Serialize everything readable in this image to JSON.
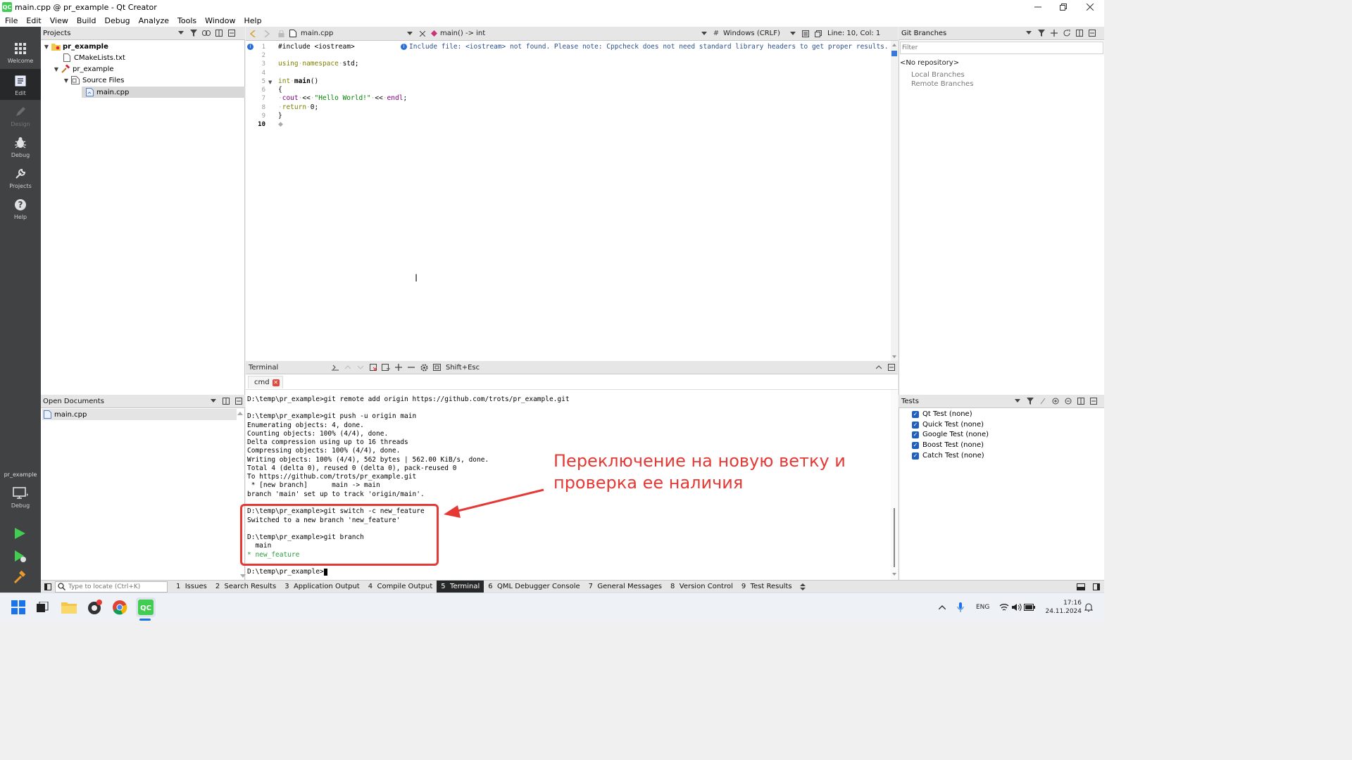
{
  "window": {
    "title": "main.cpp @ pr_example - Qt Creator",
    "logo": "QC"
  },
  "menu": [
    "File",
    "Edit",
    "View",
    "Build",
    "Debug",
    "Analyze",
    "Tools",
    "Window",
    "Help"
  ],
  "modes": [
    {
      "label": "Welcome",
      "icon": "grid-icon"
    },
    {
      "label": "Edit",
      "icon": "edit-icon"
    },
    {
      "label": "Design",
      "icon": "pencil-icon"
    },
    {
      "label": "Debug",
      "icon": "bug-icon"
    },
    {
      "label": "Projects",
      "icon": "wrench-icon"
    },
    {
      "label": "Help",
      "icon": "help-icon"
    }
  ],
  "kit": {
    "project": "pr_example",
    "mode": "Debug"
  },
  "projects": {
    "header": "Projects",
    "tree": [
      {
        "label": "pr_example",
        "bold": true
      },
      {
        "label": "CMakeLists.txt"
      },
      {
        "label": "pr_example"
      },
      {
        "label": "Source Files"
      },
      {
        "label": "main.cpp",
        "selected": true
      }
    ]
  },
  "open_documents": {
    "header": "Open Documents",
    "items": [
      "main.cpp"
    ]
  },
  "editor_toolbar": {
    "file": "main.cpp",
    "symbol": "main() -> int",
    "line_endings": "Windows (CRLF)",
    "position": "Line: 10, Col: 1",
    "hash": "#"
  },
  "editor": {
    "warning": "Include file: <iostream> not found. Please note: Cppcheck does not need standard library headers to get proper results.",
    "line_numbers": [
      "1",
      "2",
      "3",
      "4",
      "5",
      "6",
      "7",
      "8",
      "9",
      "10"
    ],
    "lines": [
      "#include <iostream>",
      "",
      "using namespace std;",
      "",
      "int main()",
      "{",
      "    cout << \"Hello World!\" << endl;",
      "    return 0;",
      "}",
      ""
    ]
  },
  "terminal": {
    "header": "Terminal",
    "shortcut": "Shift+Esc",
    "tab": "cmd",
    "lines": [
      "D:\\temp\\pr_example>git remote add origin https://github.com/trots/pr_example.git",
      "",
      "D:\\temp\\pr_example>git push -u origin main",
      "Enumerating objects: 4, done.",
      "Counting objects: 100% (4/4), done.",
      "Delta compression using up to 16 threads",
      "Compressing objects: 100% (4/4), done.",
      "Writing objects: 100% (4/4), 562 bytes | 562.00 KiB/s, done.",
      "Total 4 (delta 0), reused 0 (delta 0), pack-reused 0",
      "To https://github.com/trots/pr_example.git",
      " * [new branch]      main -> main",
      "branch 'main' set up to track 'origin/main'.",
      "",
      "D:\\temp\\pr_example>git switch -c new_feature",
      "Switched to a new branch 'new_feature'",
      "",
      "D:\\temp\\pr_example>git branch",
      "  main",
      "* new_feature",
      "",
      "D:\\temp\\pr_example>"
    ]
  },
  "git_branches": {
    "header": "Git Branches",
    "filter_placeholder": "Filter",
    "no_repo": "<No repository>",
    "local": "Local Branches",
    "remote": "Remote Branches"
  },
  "tests": {
    "header": "Tests",
    "items": [
      "Qt Test (none)",
      "Quick Test (none)",
      "Google Test (none)",
      "Boost Test (none)",
      "Catch Test (none)"
    ]
  },
  "statusbar": {
    "locate_placeholder": "Type to locate (Ctrl+K)",
    "tabs": [
      {
        "num": "1",
        "label": "Issues"
      },
      {
        "num": "2",
        "label": "Search Results"
      },
      {
        "num": "3",
        "label": "Application Output"
      },
      {
        "num": "4",
        "label": "Compile Output"
      },
      {
        "num": "5",
        "label": "Terminal",
        "active": true
      },
      {
        "num": "6",
        "label": "QML Debugger Console"
      },
      {
        "num": "7",
        "label": "General Messages"
      },
      {
        "num": "8",
        "label": "Version Control"
      },
      {
        "num": "9",
        "label": "Test Results"
      }
    ]
  },
  "annotation": {
    "line1": "Переключение на новую ветку и",
    "line2": "проверка ее наличия",
    "color": "#e53935"
  },
  "taskbar": {
    "lang": "ENG",
    "time": "17:16",
    "date": "24.11.2024"
  }
}
